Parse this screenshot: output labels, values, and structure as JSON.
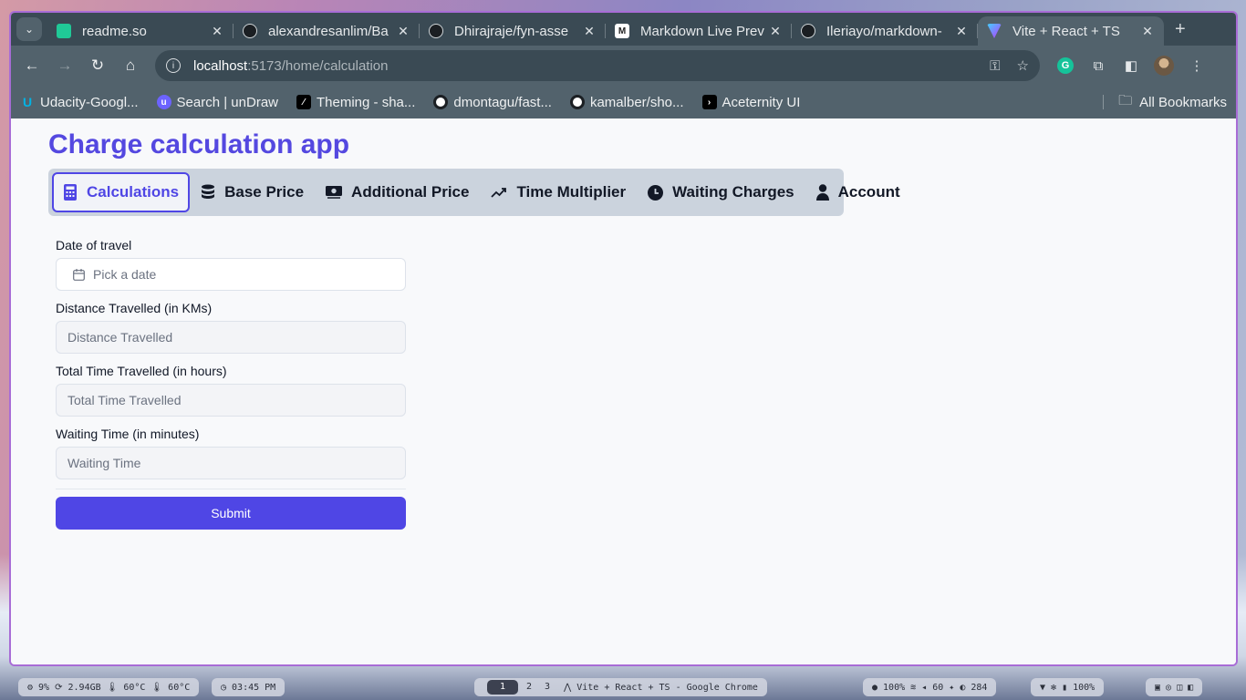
{
  "browser": {
    "tabs": [
      {
        "title": "readme.so",
        "favicon": "readme-icon",
        "color": "#20c997"
      },
      {
        "title": "alexandresanlim/Ba",
        "favicon": "github-icon",
        "color": "#1b1f23"
      },
      {
        "title": "Dhirajraje/fyn-asse",
        "favicon": "github-icon",
        "color": "#1b1f23"
      },
      {
        "title": "Markdown Live Prev",
        "favicon": "markdown-icon",
        "color": "#ffffff"
      },
      {
        "title": "Ileriayo/markdown-",
        "favicon": "github-icon",
        "color": "#1b1f23"
      },
      {
        "title": "Vite + React + TS",
        "favicon": "vite-icon",
        "color": "#a259ff"
      }
    ],
    "url": {
      "host": "localhost",
      "path": ":5173/home/calculation"
    },
    "bookmarks": [
      {
        "label": "Udacity-Googl...",
        "icon": "udacity-icon",
        "color": "#02b3e4"
      },
      {
        "label": "Search | unDraw",
        "icon": "undraw-icon",
        "color": "#6c63ff"
      },
      {
        "label": "Theming - sha...",
        "icon": "shadcn-icon",
        "color": "#000000"
      },
      {
        "label": "dmontagu/fast...",
        "icon": "github-icon",
        "color": "#1b1f23"
      },
      {
        "label": "kamalber/sho...",
        "icon": "github-icon",
        "color": "#1b1f23"
      },
      {
        "label": "Aceternity UI",
        "icon": "aceternity-icon",
        "color": "#000000"
      }
    ],
    "all_bookmarks": "All Bookmarks"
  },
  "app": {
    "title": "Charge calculation app",
    "accent": "#4f46e5",
    "nav": [
      {
        "label": "Calculations",
        "icon": "calculator-icon",
        "active": true
      },
      {
        "label": "Base Price",
        "icon": "coins-icon"
      },
      {
        "label": "Additional Price",
        "icon": "banknote-icon"
      },
      {
        "label": "Time Multiplier",
        "icon": "trending-up-icon"
      },
      {
        "label": "Waiting Charges",
        "icon": "clock-icon"
      },
      {
        "label": "Account",
        "icon": "user-icon"
      }
    ],
    "form": {
      "date_label": "Date of travel",
      "date_placeholder": "Pick a date",
      "distance_label": "Distance Travelled (in KMs)",
      "distance_placeholder": "Distance Travelled",
      "time_label": "Total Time Travelled (in hours)",
      "time_placeholder": "Total Time Travelled",
      "waiting_label": "Waiting Time (in minutes)",
      "waiting_placeholder": "Waiting Time",
      "submit": "Submit"
    }
  },
  "taskbar": {
    "stats": "⚙ 9%  ⟳ 2.94GB  🌡 60°C  🌡 60°C",
    "clock": "◷ 03:45 PM",
    "workspaces": [
      "1",
      "2",
      "3"
    ],
    "window_title": "⋀ Vite + React + TS - Google Chrome",
    "status": "● 100%  ≋  ◂ 60  ✦ ◐ 284",
    "tray": "▼  ✻  ▮ 100%",
    "icons": "▣ ◎ ◫ ◧"
  }
}
